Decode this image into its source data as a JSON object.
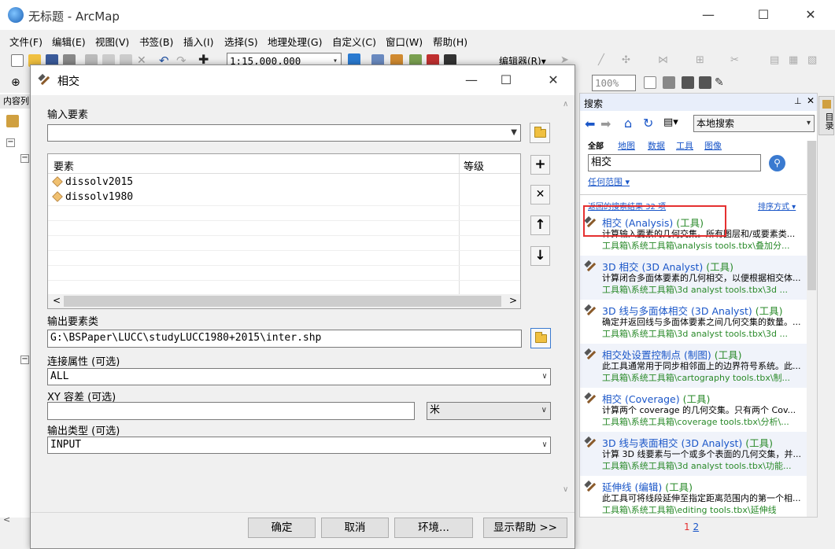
{
  "window": {
    "title": "无标题 - ArcMap"
  },
  "menu": [
    "文件(F)",
    "编辑(E)",
    "视图(V)",
    "书签(B)",
    "插入(I)",
    "选择(S)",
    "地理处理(G)",
    "自定义(C)",
    "窗口(W)",
    "帮助(H)"
  ],
  "toolbar": {
    "scale": "1:15,000,000",
    "editor_label": "编辑器(R)▾",
    "zoom_pct": "100%"
  },
  "toc": {
    "title": "内容列"
  },
  "dialog": {
    "title": "相交",
    "input_label": "输入要素",
    "table_headers": [
      "要素",
      "等级"
    ],
    "features": [
      "dissolv2015",
      "dissolv1980"
    ],
    "output_label": "输出要素类",
    "output_value": "G:\\BSPaper\\LUCC\\studyLUCC1980+2015\\inter.shp",
    "join_label": "连接属性 (可选)",
    "join_value": "ALL",
    "xy_label": "XY 容差 (可选)",
    "xy_unit": "米",
    "type_label": "输出类型 (可选)",
    "type_value": "INPUT",
    "buttons": {
      "ok": "确定",
      "cancel": "取消",
      "env": "环境...",
      "help": "显示帮助 >>"
    }
  },
  "search": {
    "panel_title": "搜索",
    "scope": "本地搜索",
    "tabs": [
      "全部",
      "地图",
      "数据",
      "工具",
      "图像"
    ],
    "query": "相交",
    "any_extent": "任何范围",
    "results_count": "返回的搜索结果 32 项",
    "sort": "排序方式",
    "results": [
      {
        "title": "相交 (Analysis) (工具)",
        "desc": "计算输入要素的几何交集。所有图层和/或要素类...",
        "path": "工具箱\\系统工具箱\\analysis tools.tbx\\叠加分..."
      },
      {
        "title": "3D 相交 (3D Analyst) (工具)",
        "desc": "计算闭合多面体要素的几何相交，以便根据相交体...",
        "path": "工具箱\\系统工具箱\\3d analyst tools.tbx\\3d ..."
      },
      {
        "title": "3D 线与多面体相交 (3D Analyst) (工具)",
        "desc": "确定并返回线与多面体要素之间几何交集的数量。...",
        "path": "工具箱\\系统工具箱\\3d analyst tools.tbx\\3d ..."
      },
      {
        "title": "相交处设置控制点 (制图) (工具)",
        "desc": "此工具通常用于同步相邻面上的边界符号系统。此...",
        "path": "工具箱\\系统工具箱\\cartography tools.tbx\\制..."
      },
      {
        "title": "相交 (Coverage) (工具)",
        "desc": "计算两个 coverage 的几何交集。只有两个 Cov...",
        "path": "工具箱\\系统工具箱\\coverage tools.tbx\\分析\\..."
      },
      {
        "title": "3D 线与表面相交 (3D Analyst) (工具)",
        "desc": "计算 3D 线要素与一个或多个表面的几何交集，并...",
        "path": "工具箱\\系统工具箱\\3d analyst tools.tbx\\功能..."
      },
      {
        "title": "延伸线 (编辑) (工具)",
        "desc": "此工具可将线段延伸至指定距离范围内的第一个相...",
        "path": "工具箱\\系统工具箱\\editing tools.tbx\\延伸线"
      }
    ],
    "pages": [
      "1",
      "2"
    ]
  },
  "side_tab": "目录",
  "colors": {
    "link": "#1a56c8",
    "green": "#2a8a2a",
    "highlight": "#e53030"
  }
}
